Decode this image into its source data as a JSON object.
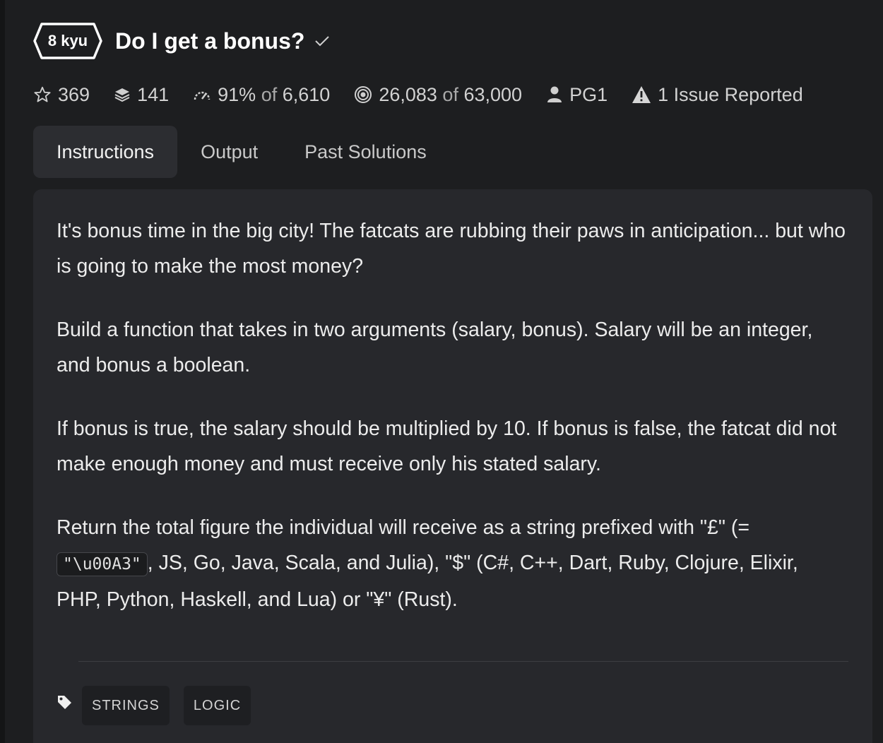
{
  "kata": {
    "rank": "8 kyu",
    "title": "Do I get a bonus?"
  },
  "stats": {
    "stars": "369",
    "collections": "141",
    "satisfaction": "91%",
    "satisfaction_of": "of",
    "votes": "6,610",
    "completed": "26,083",
    "completed_of": "of",
    "attempts": "63,000",
    "author": "PG1",
    "issues": "1 Issue Reported"
  },
  "tabs": [
    {
      "label": "Instructions",
      "active": true
    },
    {
      "label": "Output",
      "active": false
    },
    {
      "label": "Past Solutions",
      "active": false
    }
  ],
  "description": {
    "p1": "It's bonus time in the big city! The fatcats are rubbing their paws in anticipation... but who is going to make the most money?",
    "p2": "Build a function that takes in two arguments (salary, bonus). Salary will be an integer, and bonus a boolean.",
    "p3": "If bonus is true, the salary should be multiplied by 10. If bonus is false, the fatcat did not make enough money and must receive only his stated salary.",
    "p4_before": "Return the total figure the individual will receive as a string prefixed with \"£\" (= ",
    "p4_code": "\"\\u00A3\"",
    "p4_after": ", JS, Go, Java, Scala, and Julia), \"$\" (C#, C++, Dart, Ruby, Clojure, Elixir, PHP, Python, Haskell, and Lua) or \"¥\" (Rust)."
  },
  "tags": [
    "STRINGS",
    "LOGIC"
  ],
  "icons": {
    "stars": "star-icon",
    "collections": "stack-icon",
    "satisfaction": "gauge-icon",
    "completed": "target-icon",
    "author": "user-icon",
    "issues": "warning-icon",
    "tags": "tag-icon",
    "completed_mark": "check-icon"
  },
  "colors": {
    "background": "#1d1e20",
    "panel": "#27282c",
    "active_tab": "#2c2d31",
    "text": "#ececec"
  }
}
